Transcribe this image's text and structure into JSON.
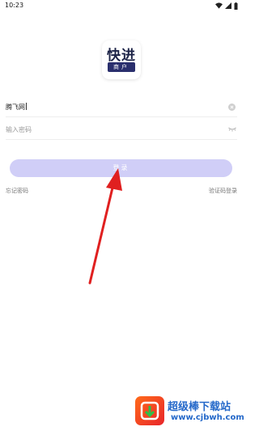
{
  "status_bar": {
    "time": "10:23",
    "icons": [
      "wifi-icon",
      "signal-icon",
      "battery-icon"
    ]
  },
  "logo": {
    "title": "快进",
    "badge": "商户"
  },
  "form": {
    "username_value": "腾飞网",
    "password_placeholder": "输入密码"
  },
  "login_button": {
    "label": "登录",
    "color": "#d0cef7"
  },
  "links": {
    "forgot_password": "忘记密码",
    "code_login": "验证码登录"
  },
  "watermark": {
    "name": "超级棒下载站",
    "url": "www.cjbwh.com"
  },
  "colors": {
    "accent": "#d0cef7",
    "arrow": "#e02020",
    "logo_dark": "#1c2347"
  }
}
